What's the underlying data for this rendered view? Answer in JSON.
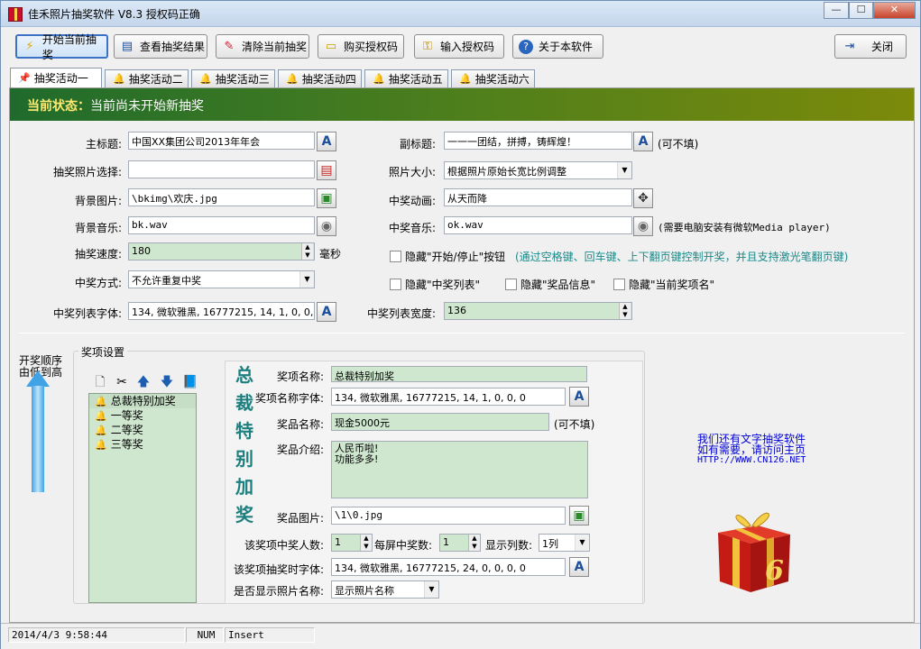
{
  "window": {
    "title": "佳禾照片抽奖软件 V8.3 授权码正确"
  },
  "toolbar": {
    "start": "开始当前抽奖",
    "view_results": "查看抽奖结果",
    "clear": "清除当前抽奖",
    "buy": "购买授权码",
    "enter_code": "输入授权码",
    "about": "关于本软件",
    "close": "关闭"
  },
  "tabs": [
    "抽奖活动一",
    "抽奖活动二",
    "抽奖活动三",
    "抽奖活动四",
    "抽奖活动五",
    "抽奖活动六"
  ],
  "status": {
    "prefix": "当前状态：",
    "text": "当前尚未开始新抽奖"
  },
  "form": {
    "main_title_label": "主标题:",
    "main_title": "中国XX集团公司2013年年会",
    "sub_title_label": "副标题:",
    "sub_title": "一一一团结，拼搏，铸辉煌！",
    "sub_title_note": "(可不填)",
    "photo_select_label": "抽奖照片选择:",
    "photo_select": "",
    "photo_size_label": "照片大小:",
    "photo_size": "根据照片原始长宽比例调整",
    "bg_image_label": "背景图片:",
    "bg_image": "\\bkimg\\欢庆.jpg",
    "win_anim_label": "中奖动画:",
    "win_anim": "从天而降",
    "bg_music_label": "背景音乐:",
    "bg_music": "bk.wav",
    "win_music_label": "中奖音乐:",
    "win_music": "ok.wav",
    "win_music_note": "(需要电脑安装有微软Media player)",
    "speed_label": "抽奖速度:",
    "speed": "180",
    "speed_unit": "毫秒",
    "hide_start_stop": "隐藏\"开始/停止\"按钮",
    "hide_start_stop_note": "(通过空格键、回车键、上下翻页键控制开奖，并且支持激光笔翻页键)",
    "win_mode_label": "中奖方式:",
    "win_mode": "不允许重复中奖",
    "hide_win_list": "隐藏\"中奖列表\"",
    "hide_prize_info": "隐藏\"奖品信息\"",
    "hide_current_prize": "隐藏\"当前奖项名\"",
    "list_font_label": "中奖列表字体:",
    "list_font": "134, 微软雅黑, 16777215, 14, 1, 0, 0, 0",
    "list_width_label": "中奖列表宽度:",
    "list_width": "136"
  },
  "prizes": {
    "group_label": "奖项设置",
    "order_label": "开奖顺序由低到高",
    "items": [
      "总裁特别加奖",
      "一等奖",
      "二等奖",
      "三等奖"
    ],
    "selected_title": "总裁特别加奖",
    "name_label": "奖项名称:",
    "name": "总裁特别加奖",
    "name_font_label": "奖项名称字体:",
    "name_font": "134, 微软雅黑, 16777215, 14, 1, 0, 0, 0",
    "item_label": "奖品名称:",
    "item": "现金5000元",
    "item_note": "(可不填)",
    "intro_label": "奖品介绍:",
    "intro_line1": "人民币啦!",
    "intro_line2": "功能多多!",
    "image_label": "奖品图片:",
    "image": "\\1\\0.jpg",
    "winners_label": "该奖项中奖人数:",
    "winners": "1",
    "per_screen_label": "每屏中奖数:",
    "per_screen": "1",
    "columns_label": "显示列数:",
    "columns": "1列",
    "draw_font_label": "该奖项抽奖时字体:",
    "draw_font": "134, 微软雅黑, 16777215, 24, 0, 0, 0, 0",
    "show_name_label": "是否显示照片名称:",
    "show_name": "显示照片名称"
  },
  "promo": {
    "line1": "我们还有文字抽奖软件",
    "line2": "如有需要，请访问主页",
    "line3": "HTTP://WWW.CN126.NET"
  },
  "statusbar": {
    "datetime": "2014/4/3 9:58:44",
    "num": "NUM",
    "insert": "Insert"
  }
}
